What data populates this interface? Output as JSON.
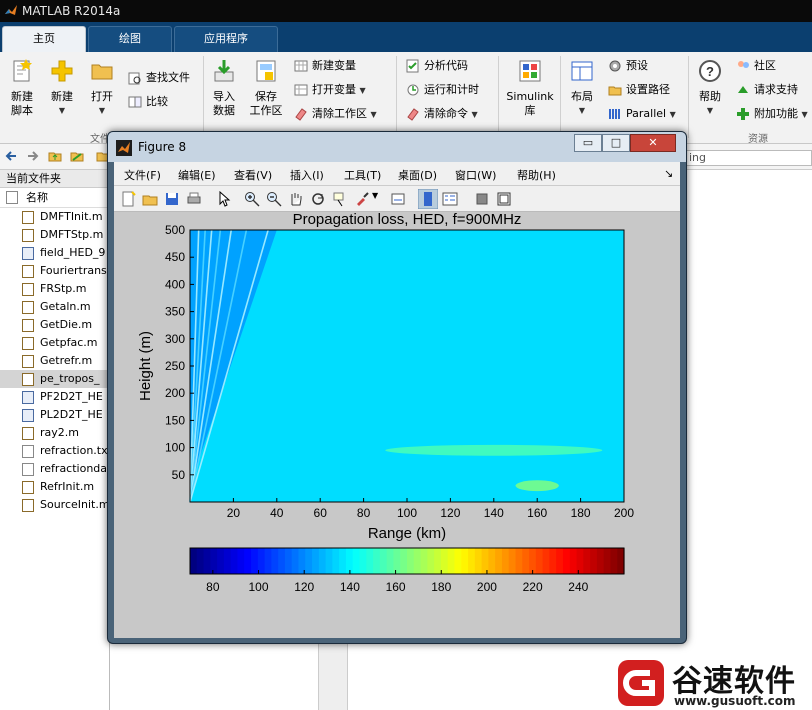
{
  "app": {
    "title": "MATLAB R2014a"
  },
  "tabs": [
    "主页",
    "绘图",
    "应用程序"
  ],
  "ribbon": {
    "new_script": [
      "新建",
      "脚本"
    ],
    "new": "新建",
    "open": "打开",
    "find_files": "查找文件",
    "compare": "比较",
    "import_data": [
      "导入",
      "数据"
    ],
    "save_workspace": [
      "保存",
      "工作区"
    ],
    "new_variable": "新建变量",
    "open_variable": "打开变量",
    "clear_workspace": "清除工作区",
    "analyze_code": "分析代码",
    "run_and_time": "运行和计时",
    "clear_commands": "清除命令",
    "simulink": [
      "Simulink",
      "库"
    ],
    "layout": "布局",
    "preferences": "预设",
    "set_path": "设置路径",
    "parallel": "Parallel",
    "help": "帮助",
    "community": "社区",
    "request_support": "请求支持",
    "addons": "附加功能",
    "group_file": "文件",
    "group_resources": "资源"
  },
  "address": {
    "right_text": "ing"
  },
  "file_panel": {
    "title": "当前文件夹",
    "name_header": "名称",
    "files": [
      {
        "name": "DMFTInit.m",
        "type": "m"
      },
      {
        "name": "DMFTStp.m",
        "type": "m"
      },
      {
        "name": "field_HED_9",
        "type": "fig"
      },
      {
        "name": "Fouriertrans",
        "type": "m"
      },
      {
        "name": "FRStp.m",
        "type": "m"
      },
      {
        "name": "Getaln.m",
        "type": "m"
      },
      {
        "name": "GetDie.m",
        "type": "m"
      },
      {
        "name": "Getpfac.m",
        "type": "m"
      },
      {
        "name": "Getrefr.m",
        "type": "m"
      },
      {
        "name": "pe_tropos_",
        "type": "m",
        "selected": true
      },
      {
        "name": "PF2D2T_HE",
        "type": "fig"
      },
      {
        "name": "PL2D2T_HE",
        "type": "fig"
      },
      {
        "name": "ray2.m",
        "type": "m"
      },
      {
        "name": "refraction.tx",
        "type": "txt"
      },
      {
        "name": "refractionda",
        "type": "txt"
      },
      {
        "name": "RefrInit.m",
        "type": "m"
      },
      {
        "name": "SourceInit.m",
        "type": "m"
      }
    ]
  },
  "figure": {
    "title": "Figure 8",
    "buttons": {
      "minimize": "▭",
      "maximize": "□",
      "close": "✕"
    },
    "menu": [
      "文件(F)",
      "编辑(E)",
      "查看(V)",
      "插入(I)",
      "工具(T)",
      "桌面(D)",
      "窗口(W)",
      "帮助(H)"
    ],
    "menu_arrow": "↘"
  },
  "chart_data": {
    "type": "heatmap",
    "title": "Propagation loss, HED, f=900MHz",
    "xlabel": "Range (km)",
    "ylabel": "Height (m)",
    "xlim": [
      0,
      200
    ],
    "ylim": [
      0,
      500
    ],
    "xticks": [
      20,
      40,
      60,
      80,
      100,
      120,
      140,
      160,
      180,
      200
    ],
    "yticks": [
      50,
      100,
      150,
      200,
      250,
      300,
      350,
      400,
      450,
      500
    ],
    "colorbar": {
      "ticks": [
        80,
        100,
        120,
        140,
        160,
        180,
        200,
        220,
        240
      ],
      "range": [
        70,
        260
      ],
      "colormap": "jet"
    },
    "field": {
      "dominant_loss_dB": 135,
      "near_source_loss_dB": 120,
      "high_loss_bands": [
        {
          "range_km": [
            90,
            190
          ],
          "height_m": [
            85,
            105
          ],
          "loss_dB": 155
        },
        {
          "range_km": [
            150,
            170
          ],
          "height_m": [
            20,
            40
          ],
          "loss_dB": 165
        }
      ]
    },
    "grid": false,
    "legend": "none"
  },
  "watermark": {
    "brand": "谷速软件",
    "url": "www.gusuoft.com"
  },
  "colors": {
    "tabbar": "#0b3f6f",
    "ribbon": "#f2f2f2",
    "figure_frame": "#4a6378",
    "plot_bg": "#0a8dff"
  }
}
